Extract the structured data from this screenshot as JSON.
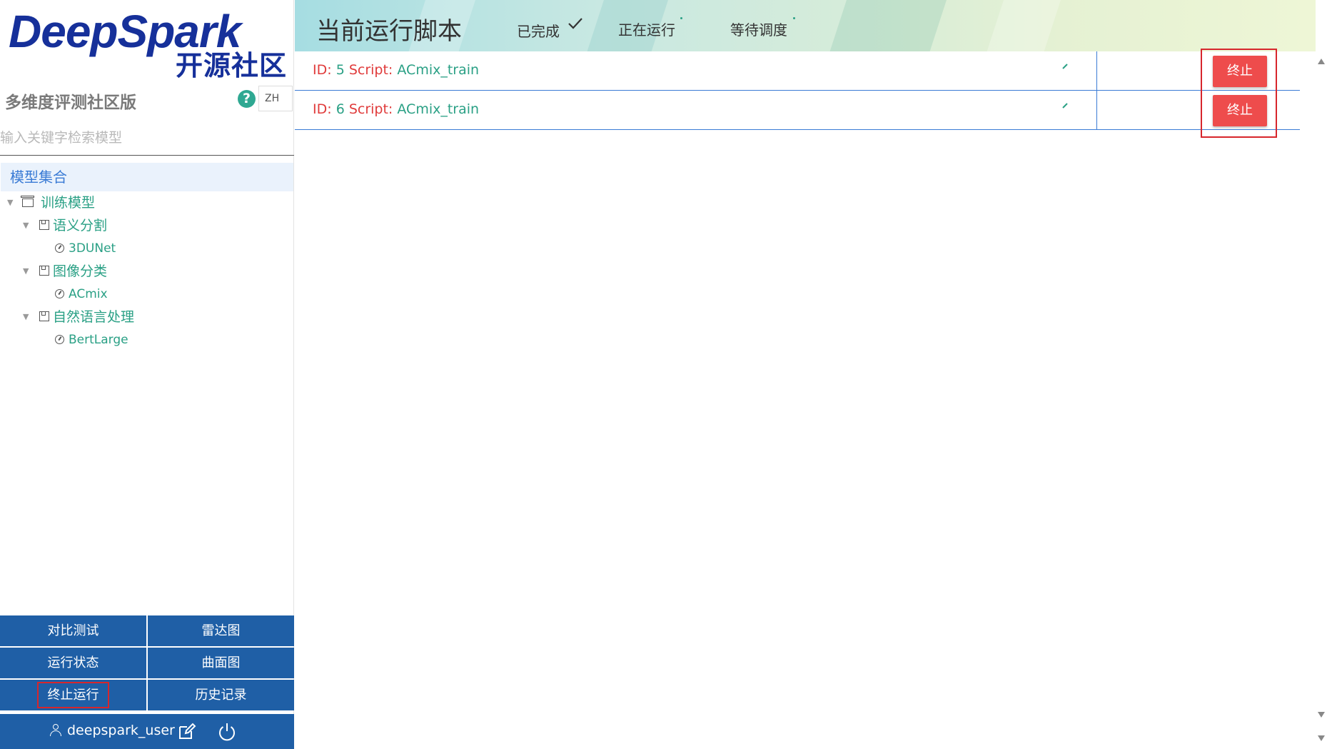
{
  "brand": {
    "logo_top": "DeepSpark",
    "logo_bottom": "开源社区",
    "subtitle": "多维度评测社区版",
    "language": "ZH",
    "help_icon": "question-circle-icon"
  },
  "search": {
    "placeholder": "输入关键字检索模型",
    "value": ""
  },
  "tree": {
    "header": "模型集合",
    "root": "训练模型",
    "groups": [
      {
        "label": "语义分割",
        "children": [
          "3DUNet"
        ]
      },
      {
        "label": "图像分类",
        "children": [
          "ACmix"
        ]
      },
      {
        "label": "自然语言处理",
        "children": [
          "BertLarge"
        ]
      }
    ]
  },
  "menu": {
    "items": [
      "对比测试",
      "雷达图",
      "运行状态",
      "曲面图",
      "终止运行",
      "历史记录"
    ],
    "highlighted": "终止运行"
  },
  "user": {
    "name": "deepspark_user",
    "icons": [
      "user-icon",
      "edit-icon",
      "power-icon"
    ]
  },
  "banner": {
    "title": "当前运行脚本",
    "tabs": [
      "已完成",
      "正在运行",
      "等待调度"
    ],
    "check_icon": "checkmark-icon"
  },
  "scripts": [
    {
      "id_label": "ID:",
      "id": "5",
      "script_label": "Script:",
      "script": "ACmix_train",
      "action": "终止"
    },
    {
      "id_label": "ID:",
      "id": "6",
      "script_label": "Script:",
      "script": "ACmix_train",
      "action": "终止"
    }
  ],
  "colors": {
    "brand_blue": "#16309a",
    "menu_blue": "#1f5fa6",
    "teal": "#2aa085",
    "stop_red": "#ee4c4c",
    "highlight_red": "#d7262c"
  }
}
